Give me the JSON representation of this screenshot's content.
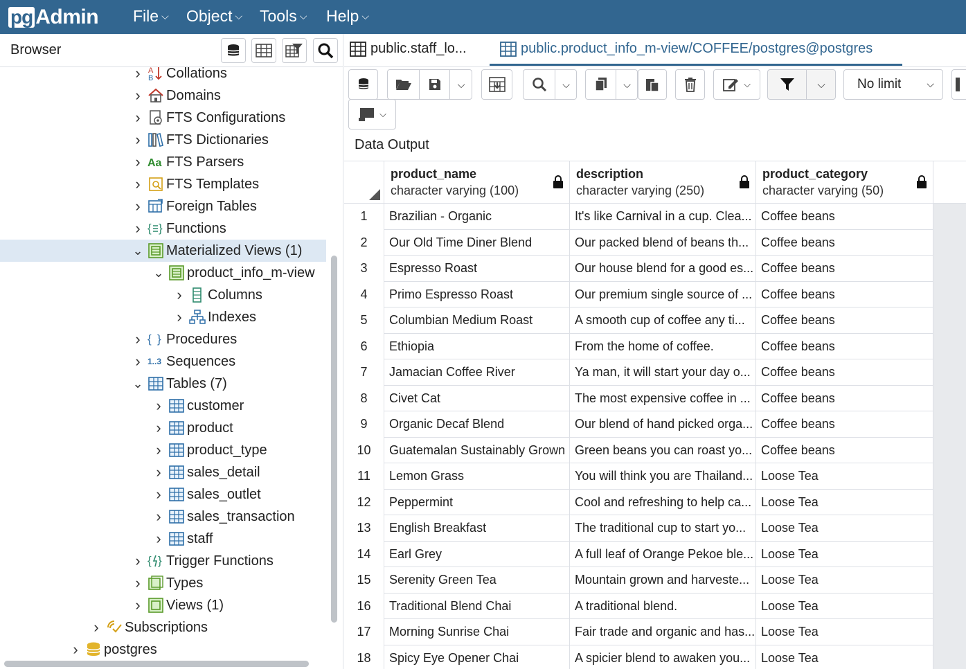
{
  "app": {
    "logo_pg": "pg",
    "logo_admin": "Admin"
  },
  "menu": [
    {
      "label": "File"
    },
    {
      "label": "Object"
    },
    {
      "label": "Tools"
    },
    {
      "label": "Help"
    }
  ],
  "browser": {
    "title": "Browser"
  },
  "tree": [
    {
      "label": "Collations",
      "icon": "collation-icon",
      "expanded": false
    },
    {
      "label": "Domains",
      "icon": "domain-icon",
      "expanded": false
    },
    {
      "label": "FTS Configurations",
      "icon": "fts-config-icon",
      "expanded": false
    },
    {
      "label": "FTS Dictionaries",
      "icon": "fts-dictionary-icon",
      "expanded": false
    },
    {
      "label": "FTS Parsers",
      "icon": "fts-parser-icon",
      "expanded": false
    },
    {
      "label": "FTS Templates",
      "icon": "fts-template-icon",
      "expanded": false
    },
    {
      "label": "Foreign Tables",
      "icon": "foreign-table-icon",
      "expanded": false
    },
    {
      "label": "Functions",
      "icon": "function-icon",
      "expanded": false
    },
    {
      "label": "Materialized Views (1)",
      "icon": "materialized-view-icon",
      "expanded": true,
      "selected": true
    },
    {
      "label": "product_info_m-view",
      "icon": "materialized-view-icon",
      "expanded": true
    },
    {
      "label": "Columns",
      "icon": "columns-icon",
      "expanded": false
    },
    {
      "label": "Indexes",
      "icon": "indexes-icon",
      "expanded": false
    },
    {
      "label": "Procedures",
      "icon": "procedure-icon",
      "expanded": false
    },
    {
      "label": "Sequences",
      "icon": "sequence-icon",
      "expanded": false
    },
    {
      "label": "Tables (7)",
      "icon": "table-icon",
      "expanded": true
    },
    {
      "label": "customer",
      "icon": "table-icon",
      "expanded": false
    },
    {
      "label": "product",
      "icon": "table-icon",
      "expanded": false
    },
    {
      "label": "product_type",
      "icon": "table-icon",
      "expanded": false
    },
    {
      "label": "sales_detail",
      "icon": "table-icon",
      "expanded": false
    },
    {
      "label": "sales_outlet",
      "icon": "table-icon",
      "expanded": false
    },
    {
      "label": "sales_transaction",
      "icon": "table-icon",
      "expanded": false
    },
    {
      "label": "staff",
      "icon": "table-icon",
      "expanded": false
    },
    {
      "label": "Trigger Functions",
      "icon": "trigger-function-icon",
      "expanded": false
    },
    {
      "label": "Types",
      "icon": "type-icon",
      "expanded": false
    },
    {
      "label": "Views (1)",
      "icon": "view-icon",
      "expanded": false
    },
    {
      "label": "Subscriptions",
      "icon": "subscription-icon",
      "expanded": false
    },
    {
      "label": "postgres",
      "icon": "database-icon",
      "expanded": false
    }
  ],
  "tabs": [
    {
      "label": "public.staff_lo..."
    },
    {
      "label": "public.product_info_m-view/COFFEE/postgres@postgres",
      "active": true
    }
  ],
  "toolbar": {
    "limit": "No limit"
  },
  "output": {
    "title": "Data Output"
  },
  "columns": [
    {
      "name": "product_name",
      "type": "character varying (100)"
    },
    {
      "name": "description",
      "type": "character varying (250)"
    },
    {
      "name": "product_category",
      "type": "character varying (50)"
    }
  ],
  "rows": [
    {
      "n": "1",
      "name": "Brazilian - Organic",
      "desc": "It's like Carnival in a cup. Clea...",
      "cat": "Coffee beans"
    },
    {
      "n": "2",
      "name": "Our Old Time Diner Blend",
      "desc": "Our packed blend of beans th...",
      "cat": "Coffee beans"
    },
    {
      "n": "3",
      "name": "Espresso Roast",
      "desc": "Our house blend for a good es...",
      "cat": "Coffee beans"
    },
    {
      "n": "4",
      "name": "Primo Espresso Roast",
      "desc": "Our premium single source of ...",
      "cat": "Coffee beans"
    },
    {
      "n": "5",
      "name": "Columbian Medium Roast",
      "desc": "A smooth cup of coffee any ti...",
      "cat": "Coffee beans"
    },
    {
      "n": "6",
      "name": "Ethiopia",
      "desc": "From the home of coffee.",
      "cat": "Coffee beans"
    },
    {
      "n": "7",
      "name": "Jamacian Coffee River",
      "desc": "Ya man, it will start your day o...",
      "cat": "Coffee beans"
    },
    {
      "n": "8",
      "name": "Civet Cat",
      "desc": "The most expensive coffee in ...",
      "cat": "Coffee beans"
    },
    {
      "n": "9",
      "name": "Organic Decaf Blend",
      "desc": "Our blend of hand picked orga...",
      "cat": "Coffee beans"
    },
    {
      "n": "10",
      "name": "Guatemalan Sustainably Grown",
      "desc": "Green beans you can roast yo...",
      "cat": "Coffee beans"
    },
    {
      "n": "11",
      "name": "Lemon Grass",
      "desc": "You will think you are Thailand...",
      "cat": "Loose Tea"
    },
    {
      "n": "12",
      "name": "Peppermint",
      "desc": "Cool and refreshing to help ca...",
      "cat": "Loose Tea"
    },
    {
      "n": "13",
      "name": "English Breakfast",
      "desc": "The traditional cup to start yo...",
      "cat": "Loose Tea"
    },
    {
      "n": "14",
      "name": "Earl Grey",
      "desc": "A full leaf of Orange Pekoe ble...",
      "cat": "Loose Tea"
    },
    {
      "n": "15",
      "name": "Serenity Green Tea",
      "desc": "Mountain grown and harveste...",
      "cat": "Loose Tea"
    },
    {
      "n": "16",
      "name": "Traditional Blend Chai",
      "desc": "A traditional blend.",
      "cat": "Loose Tea"
    },
    {
      "n": "17",
      "name": "Morning Sunrise Chai",
      "desc": "Fair trade and organic and has...",
      "cat": "Loose Tea"
    },
    {
      "n": "18",
      "name": "Spicy Eye Opener Chai",
      "desc": "A spicier blend to awaken you...",
      "cat": "Loose Tea"
    }
  ]
}
